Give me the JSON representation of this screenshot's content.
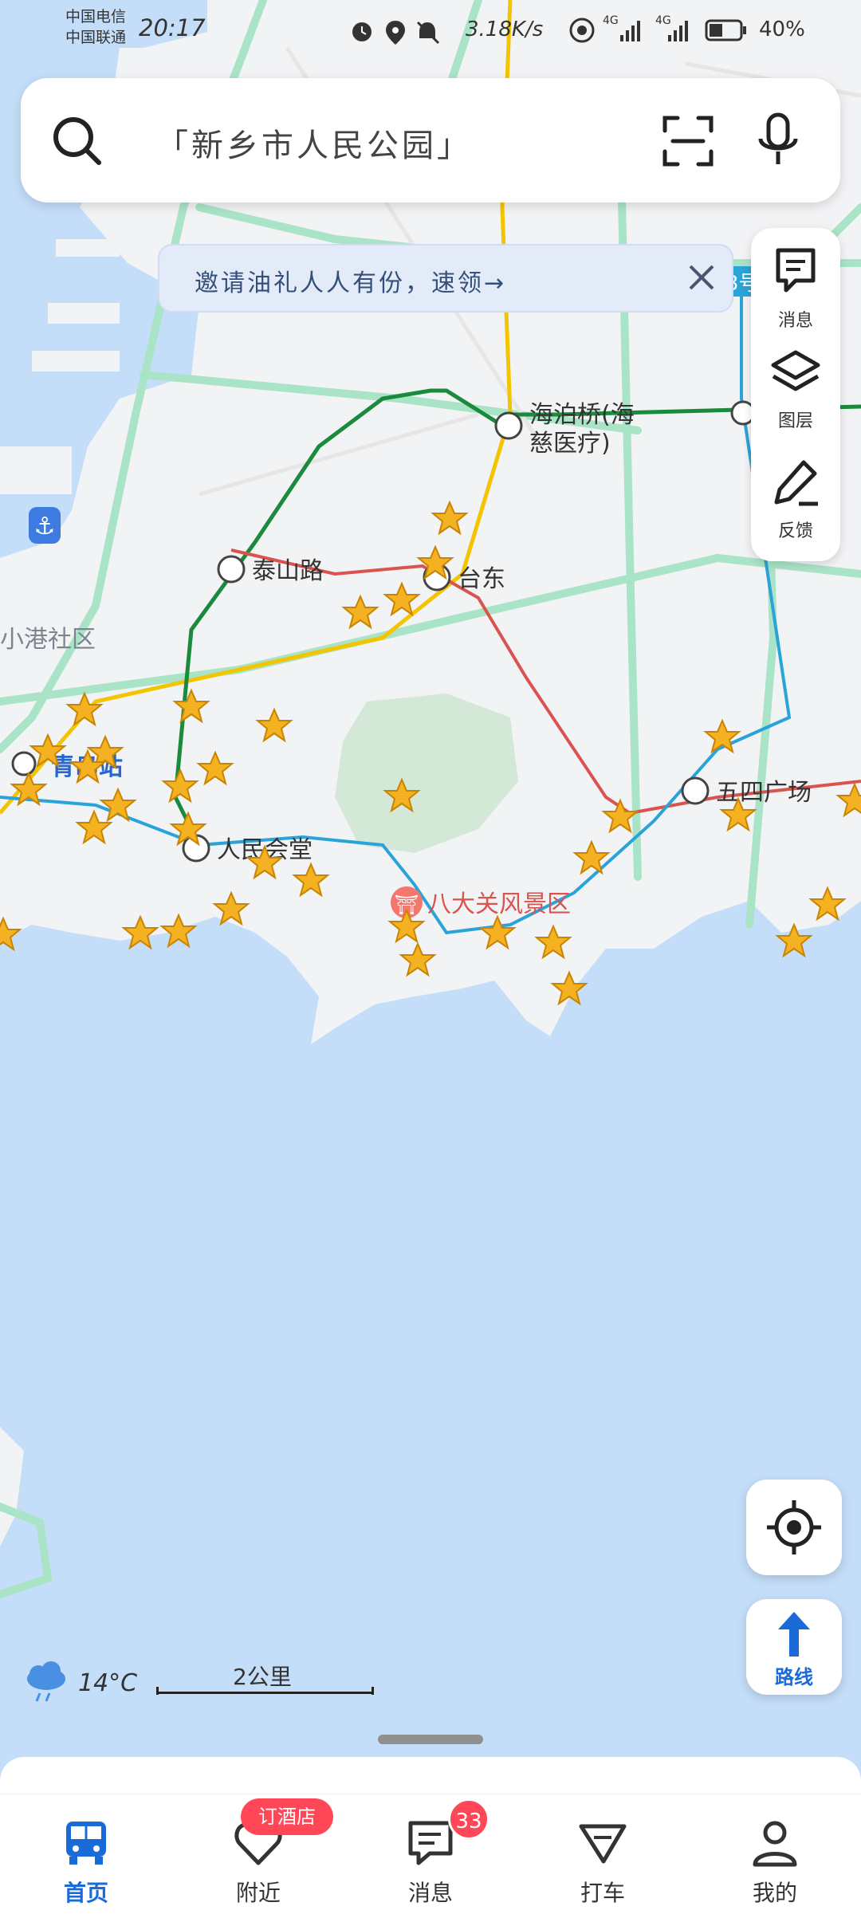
{
  "status_bar": {
    "carrier_1": "中国电信",
    "carrier_2": "中国联通",
    "time": "20:17",
    "net_speed": "3.18K/s",
    "signal_1": "4G",
    "signal_2": "4G",
    "battery": "40%"
  },
  "search": {
    "placeholder": "「新乡市人民公园」"
  },
  "banner": {
    "text": "邀请油礼人人有份，速领→"
  },
  "side_panel": {
    "items": [
      {
        "label": "消息",
        "icon": "message-icon"
      },
      {
        "label": "图层",
        "icon": "layers-icon"
      },
      {
        "label": "反馈",
        "icon": "feedback-pen-icon"
      }
    ]
  },
  "map": {
    "labels": {
      "haibo": "海泊桥(海",
      "haibo2": "慈医疗)",
      "taishan": "泰山路",
      "taidong": "台东",
      "xiaogang": "小港社区",
      "qingdao_station": "青岛站",
      "renmin": "人民会堂",
      "badaguan": "八大关风景区",
      "wusi": "五四广场",
      "line_tag": "3号"
    },
    "colors": {
      "water": "#c4def9",
      "land": "#f2f3f5",
      "park": "#d3e8d6",
      "road": "#a9e4c7",
      "metro_yellow": "#f5c400",
      "metro_green": "#1a8a3c",
      "metro_red": "#d9534f",
      "metro_blue": "#2aa3d8"
    }
  },
  "weather": {
    "icon": "cloud-rain-icon",
    "temperature": "14°C"
  },
  "scale": {
    "label": "2公里"
  },
  "route_button": {
    "label": "路线"
  },
  "tabbar": {
    "tabs": [
      {
        "label": "首页",
        "icon": "bus-icon",
        "active": true
      },
      {
        "label": "附近",
        "icon": "nearby-heart-icon",
        "active": false
      },
      {
        "label": "消息",
        "icon": "message-icon",
        "active": false
      },
      {
        "label": "打车",
        "icon": "taxi-icon",
        "active": false
      },
      {
        "label": "我的",
        "icon": "profile-icon",
        "active": false
      }
    ],
    "nearby_badge": "订酒店",
    "message_badge": "33"
  }
}
